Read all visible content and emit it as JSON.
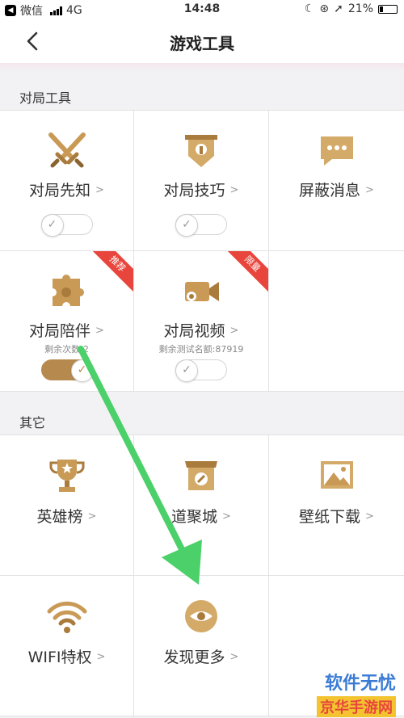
{
  "status_bar": {
    "carrier": "微信",
    "network": "4G",
    "time": "14:48",
    "battery": "21%",
    "battery_level": 0.21
  },
  "nav": {
    "title": "游戏工具"
  },
  "sections": [
    {
      "title": "对局工具",
      "items": [
        {
          "label": "对局先知",
          "icon": "crossed-swords-icon",
          "toggle": "off"
        },
        {
          "label": "对局技巧",
          "icon": "banner-shield-icon",
          "toggle": "off"
        },
        {
          "label": "屏蔽消息",
          "icon": "chat-bubble-icon"
        },
        {
          "label": "对局陪伴",
          "icon": "puzzle-icon",
          "sub": "剩余次数:2",
          "badge": "推荐",
          "toggle": "on"
        },
        {
          "label": "对局视频",
          "icon": "video-camera-icon",
          "sub": "剩余测试名额:87919",
          "badge": "限量",
          "toggle": "off"
        }
      ]
    },
    {
      "title": "其它",
      "items": [
        {
          "label": "英雄榜",
          "icon": "trophy-icon"
        },
        {
          "label": "道聚城",
          "icon": "shop-icon"
        },
        {
          "label": "壁纸下载",
          "icon": "picture-icon"
        },
        {
          "label": "WIFI特权",
          "icon": "wifi-icon"
        },
        {
          "label": "发现更多",
          "icon": "discover-eye-icon"
        }
      ]
    }
  ],
  "watermark": {
    "line1": "软件无忧",
    "line2": "京华手游网"
  },
  "colors": {
    "gold": "#b68a4f",
    "ribbon": "#e8463c",
    "arrow": "#4bd06a"
  }
}
